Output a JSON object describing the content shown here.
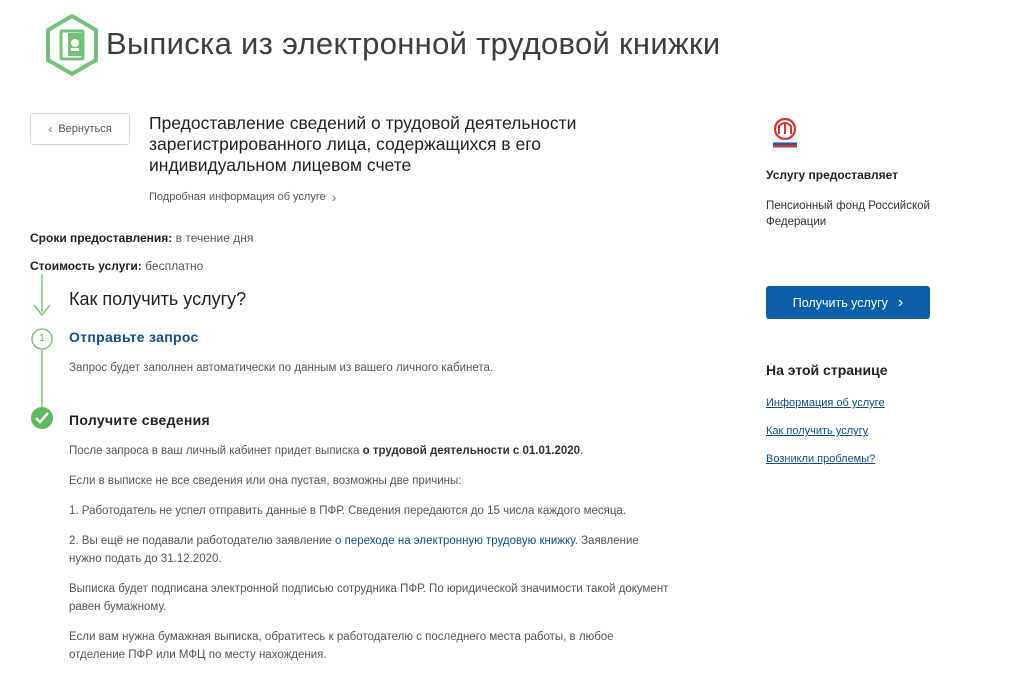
{
  "header": {
    "logo_icon": "pfr-emblem-icon",
    "title": "Выписка из электронной трудовой книжки"
  },
  "nav": {
    "back_label": "Вернуться"
  },
  "service": {
    "title": "Предоставление сведений о трудовой деятельности зарегистрированного лица, содержащихся в его индивидуальном лицевом счете",
    "info_link": "Подробная информация об услуге",
    "terms_label": "Сроки предоставления:",
    "terms_value": "в течение дня",
    "cost_label": "Стоимость услуги:",
    "cost_value": "бесплатно"
  },
  "how": {
    "title": "Как получить услугу?",
    "step1": {
      "number": "1",
      "title": "Отправьте запрос",
      "text": "Запрос будет заполнен автоматически по данным из вашего личного кабинета."
    },
    "step2": {
      "title": "Получите сведения",
      "p1_start": "После запроса в ваш личный кабинет придет выписка ",
      "p1_bold": "о трудовой деятельности с 01.01.2020",
      "p1_end": ".",
      "p2": "Если в выписке не все сведения или она пустая, возможны две причины:",
      "p3": "1. Работодатель не успел отправить данные в ПФР. Сведения передаются до 15 числа каждого месяца.",
      "p4_start": "2. Вы ещё не подавали работодателю заявление ",
      "p4_link": "о переходе на электронную трудовую книжку",
      "p4_end": ". Заявление нужно подать до 31.12.2020.",
      "p5": "Выписка будет подписана электронной подписью сотрудника ПФР. По юридической значимости такой документ равен бумажному.",
      "p6": "Если вам нужна бумажная выписка, обратитесь к работодателю с последнего места работы, в любое отделение ПФР или МФЦ по месту нахождения."
    }
  },
  "sidebar": {
    "provider_logo": "pfr-logo-icon",
    "provides_label": "Услугу предоставляет",
    "provider_name": "Пенсионный фонд Российской Федерации",
    "get_button": "Получить услугу",
    "on_page_title": "На этой странице",
    "links": [
      "Информация об услуге",
      "Как получить услугу",
      "Возникли проблемы?"
    ]
  },
  "colors": {
    "accent_green": "#5cb85c",
    "primary_blue": "#0d5ea8",
    "link_blue": "#0d4f8b"
  }
}
